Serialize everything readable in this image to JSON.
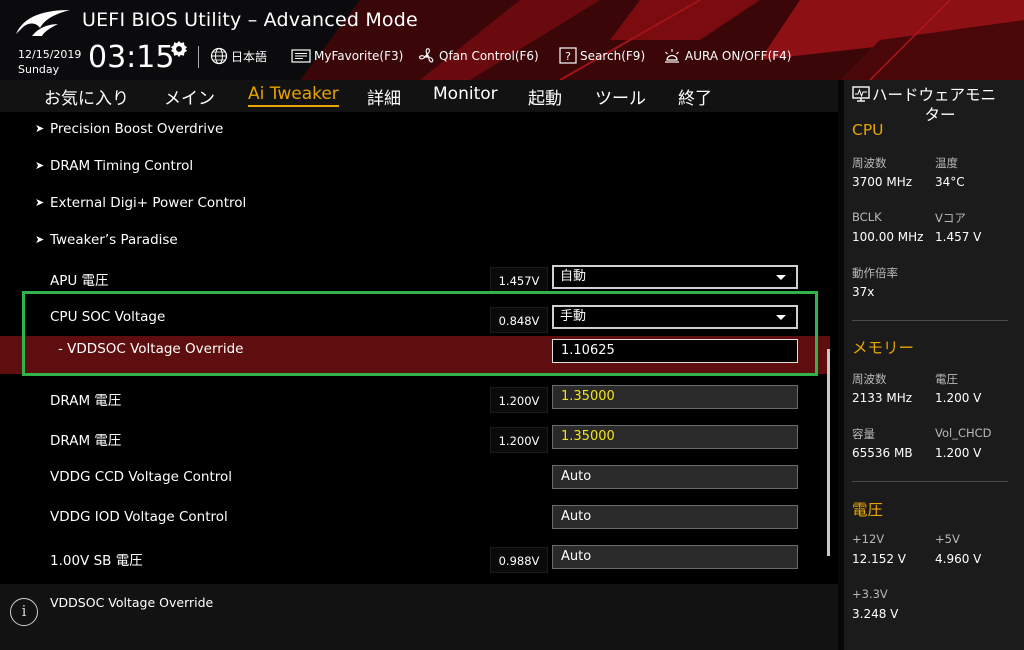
{
  "header": {
    "title": "UEFI BIOS Utility – Advanced Mode",
    "date": "12/15/2019",
    "day": "Sunday",
    "time": "03:15",
    "toolbar": [
      {
        "name": "language-button",
        "icon": "globe-icon",
        "label": "日本語"
      },
      {
        "name": "myfavorite-button",
        "icon": "myfavorite-icon",
        "label": "MyFavorite(F3)"
      },
      {
        "name": "qfan-control-button",
        "icon": "fan-icon",
        "label": "Qfan Control(F6)"
      },
      {
        "name": "search-button",
        "icon": "question-icon",
        "label": "Search(F9)"
      },
      {
        "name": "aura-button",
        "icon": "aura-light-icon",
        "label": "AURA ON/OFF(F4)"
      }
    ]
  },
  "nav": {
    "tabs": [
      "お気に入り",
      "メイン",
      "Ai Tweaker",
      "詳細",
      "Monitor",
      "起動",
      "ツール",
      "終了"
    ],
    "active": "Ai Tweaker"
  },
  "settings": {
    "submenus": [
      "Precision Boost Overdrive",
      "DRAM Timing Control",
      "External Digi+ Power Control",
      "Tweaker’s Paradise"
    ],
    "apu": {
      "label": "APU 電圧",
      "volt": "1.457V",
      "value": "自動"
    },
    "cpu_soc": {
      "label": "CPU SOC Voltage",
      "volt": "0.848V",
      "value": "手動"
    },
    "vddsoc_override": {
      "label": "- VDDSOC Voltage Override",
      "value": "1.10625"
    },
    "dram1": {
      "label": "DRAM 電圧",
      "volt": "1.200V",
      "value": "1.35000"
    },
    "dram2": {
      "label": "DRAM 電圧",
      "volt": "1.200V",
      "value": "1.35000"
    },
    "vddg_ccd": {
      "label": "VDDG CCD Voltage Control",
      "value": "Auto"
    },
    "vddg_iod": {
      "label": "VDDG IOD Voltage Control",
      "value": "Auto"
    },
    "sb": {
      "label": "1.00V SB 電圧",
      "volt": "0.988V",
      "value": "Auto"
    }
  },
  "help": {
    "text": "VDDSOC Voltage Override"
  },
  "hwmon": {
    "title_line1": "ハードウェアモニ",
    "title_line2": "ター",
    "cpu": {
      "heading": "CPU",
      "freq_label": "周波数",
      "freq": "3700 MHz",
      "temp_label": "温度",
      "temp": "34°C",
      "bclk_label": "BCLK",
      "bclk": "100.00 MHz",
      "vcore_label": "Vコア",
      "vcore": "1.457 V",
      "ratio_label": "動作倍率",
      "ratio": "37x"
    },
    "memory": {
      "heading": "メモリー",
      "freq_label": "周波数",
      "freq": "2133 MHz",
      "volt_label": "電圧",
      "volt": "1.200 V",
      "cap_label": "容量",
      "cap": "65536 MB",
      "vol_chcd_label": "Vol_CHCD",
      "vol_chcd": "1.200 V"
    },
    "voltage": {
      "heading": "電圧",
      "v12_label": "+12V",
      "v12": "12.152 V",
      "v5_label": "+5V",
      "v5": "4.960 V",
      "v33_label": "+3.3V",
      "v33": "3.248 V"
    }
  },
  "colors": {
    "accent": "#e8a400",
    "selected_row": "#5e0e0e",
    "highlight_box": "#2fb34a",
    "value_yellow": "#f2e51a"
  }
}
